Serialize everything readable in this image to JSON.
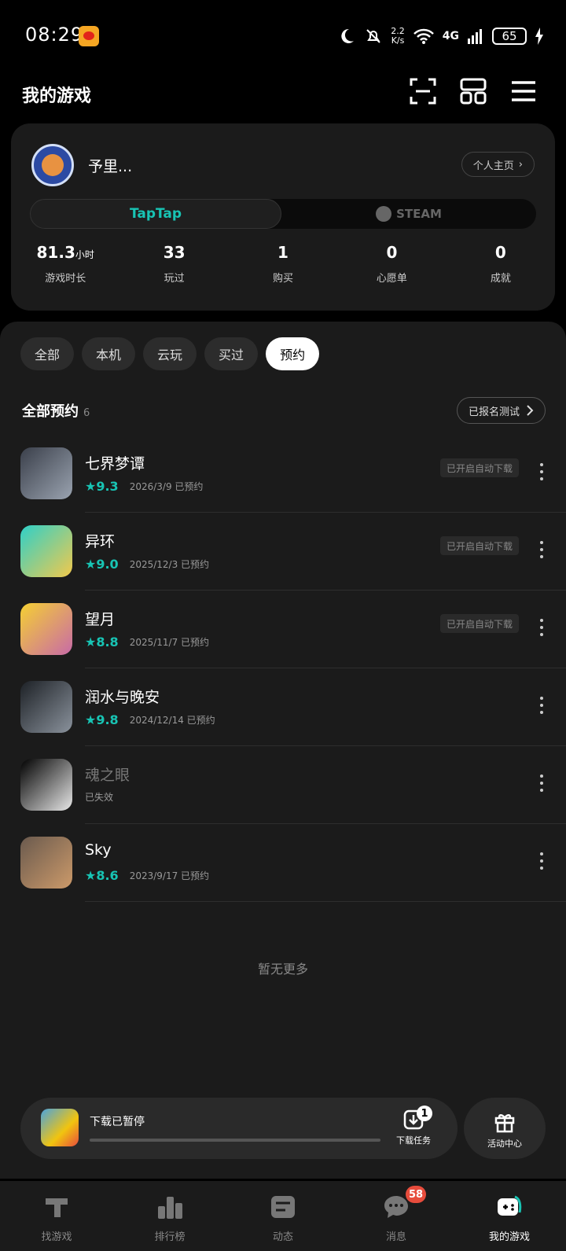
{
  "status_bar": {
    "time": "08:29",
    "net_speed_value": "2.2",
    "net_speed_unit": "K/s",
    "network": "4G",
    "battery": "65"
  },
  "header": {
    "title": "我的游戏"
  },
  "profile": {
    "username": "予里...",
    "profile_button": "个人主页",
    "platforms": {
      "taptap": "TapTap",
      "steam": "STEAM"
    },
    "stats": [
      {
        "value": "81.3",
        "unit": "小时",
        "label": "游戏时长"
      },
      {
        "value": "33",
        "unit": "",
        "label": "玩过"
      },
      {
        "value": "1",
        "unit": "",
        "label": "购买"
      },
      {
        "value": "0",
        "unit": "",
        "label": "心愿单"
      },
      {
        "value": "0",
        "unit": "",
        "label": "成就"
      }
    ]
  },
  "filters": [
    "全部",
    "本机",
    "云玩",
    "买过",
    "预约"
  ],
  "active_filter": "预约",
  "section": {
    "title": "全部预约",
    "count": "6",
    "beta_button": "已报名测试"
  },
  "games": [
    {
      "name": "七界梦谭",
      "score": "9.3",
      "date": "2026/3/9 已预约",
      "tag": "已开启自动下载",
      "icon_colors": [
        "#3a3f4a",
        "#9aa3b0"
      ]
    },
    {
      "name": "异环",
      "score": "9.0",
      "date": "2025/12/3 已预约",
      "tag": "已开启自动下载",
      "icon_colors": [
        "#2fd0c8",
        "#f2c94c"
      ]
    },
    {
      "name": "望月",
      "score": "8.8",
      "date": "2025/11/7 已预约",
      "tag": "已开启自动下载",
      "icon_colors": [
        "#f5d033",
        "#c86aa7"
      ]
    },
    {
      "name": "润水与晚安",
      "score": "9.8",
      "date": "2024/12/14 已预约",
      "tag": "",
      "icon_colors": [
        "#1d2126",
        "#8a929c"
      ]
    },
    {
      "name": "魂之眼",
      "score": "",
      "date": "已失效",
      "tag": "",
      "icon_colors": [
        "#000000",
        "#e8e8e8"
      ],
      "dim": true
    },
    {
      "name": "Sky",
      "score": "8.6",
      "date": "2023/9/17 已预约",
      "tag": "",
      "icon_colors": [
        "#6a5a4e",
        "#cc9a6a"
      ]
    }
  ],
  "no_more": "暂无更多",
  "download": {
    "status": "下载已暂停",
    "progress": 0,
    "task_label": "下载任务",
    "task_count": "1"
  },
  "event_center": "活动中心",
  "nav": [
    {
      "label": "找游戏",
      "icon": "taptap-logo-icon"
    },
    {
      "label": "排行榜",
      "icon": "ranking-icon"
    },
    {
      "label": "动态",
      "icon": "feed-icon"
    },
    {
      "label": "消息",
      "icon": "message-icon",
      "badge": "58"
    },
    {
      "label": "我的游戏",
      "icon": "gamepad-icon",
      "active": true
    }
  ]
}
